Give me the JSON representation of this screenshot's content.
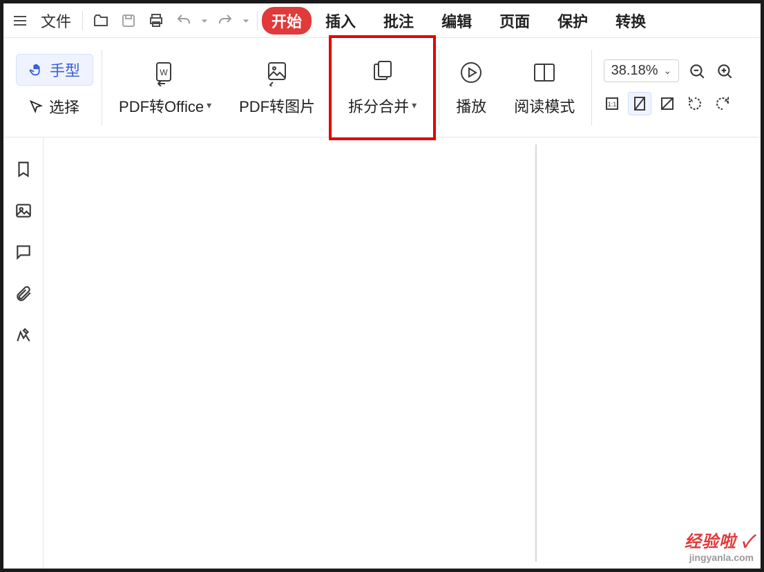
{
  "menubar": {
    "file_label": "文件",
    "tabs": {
      "start": "开始",
      "insert": "插入",
      "annotate": "批注",
      "edit": "编辑",
      "page": "页面",
      "protect": "保护",
      "convert": "转换"
    }
  },
  "tools": {
    "hand": "手型",
    "select": "选择"
  },
  "ribbon": {
    "pdf_to_office": "PDF转Office",
    "pdf_to_image": "PDF转图片",
    "split_merge": "拆分合并",
    "play": "播放",
    "read_mode": "阅读模式"
  },
  "zoom": {
    "value": "38.18%"
  },
  "watermark": {
    "line1": "经验啦",
    "check": "✓",
    "line2": "jingyanla.com"
  },
  "highlight": {
    "target": "split_merge"
  }
}
